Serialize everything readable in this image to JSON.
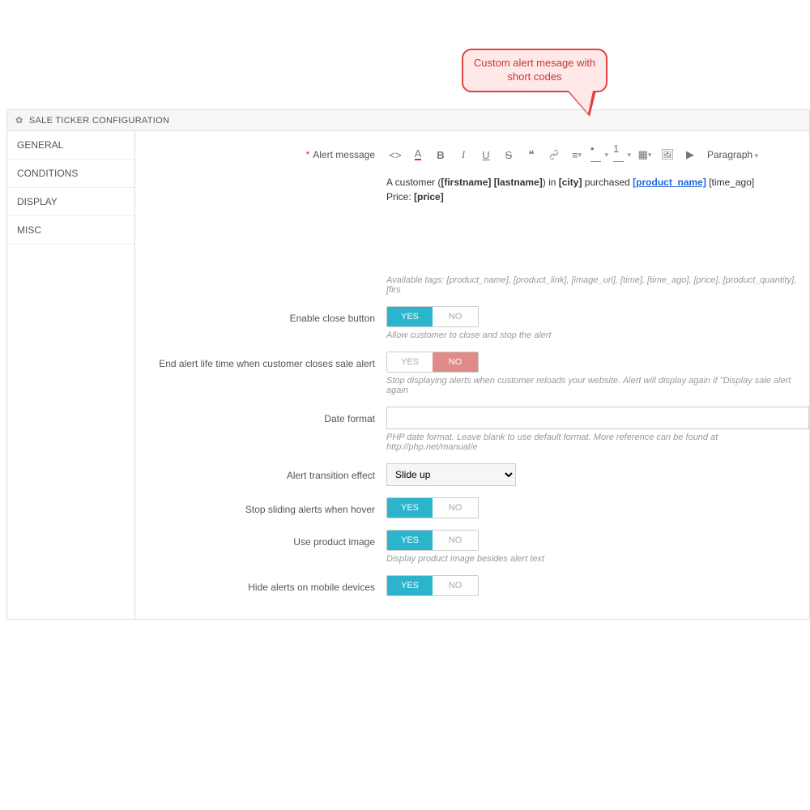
{
  "callout": {
    "text": "Custom alert mesage with short codes"
  },
  "panel": {
    "title": "SALE TICKER CONFIGURATION",
    "tabs": [
      "GENERAL",
      "CONDITIONS",
      "DISPLAY",
      "MISC"
    ],
    "active_tab": 0
  },
  "form": {
    "alert_message": {
      "label": "Alert message",
      "required_mark": "*",
      "line1_prefix": "A customer (",
      "tag_firstname": "[firstname]",
      "space1": " ",
      "tag_lastname": "[lastname]",
      "line1_mid1": ") in ",
      "tag_city": "[city]",
      "line1_mid2": " purchased ",
      "tag_product_name": "[product_name]",
      "space2": " ",
      "tag_time_ago": "[time_ago]",
      "line2_prefix": "Price: ",
      "tag_price": "[price]",
      "available_tags": "Available tags: [product_name], [product_link], [image_url], [time], [time_ago], [price], [product_quantity], [firs",
      "paragraph_label": "Paragraph"
    },
    "enable_close": {
      "label": "Enable close button",
      "yes": "YES",
      "no": "NO",
      "value": "yes",
      "help": "Allow customer to close and stop the alert"
    },
    "end_life": {
      "label": "End alert life time when customer closes sale alert",
      "yes": "YES",
      "no": "NO",
      "value": "no",
      "help": "Stop displaying alerts when customer reloads your website. Alert will display again if \"Display sale alert again"
    },
    "date_format": {
      "label": "Date format",
      "value": "",
      "help": "PHP date format. Leave blank to use default format. More reference can be found at http://php.net/manual/e"
    },
    "transition": {
      "label": "Alert transition effect",
      "value": "Slide up"
    },
    "stop_hover": {
      "label": "Stop sliding alerts when hover",
      "yes": "YES",
      "no": "NO",
      "value": "yes"
    },
    "use_img": {
      "label": "Use product image",
      "yes": "YES",
      "no": "NO",
      "value": "yes",
      "help": "Display product image besides alert text"
    },
    "hide_mobile": {
      "label": "Hide alerts on mobile devices",
      "yes": "YES",
      "no": "NO",
      "value": "yes"
    }
  }
}
